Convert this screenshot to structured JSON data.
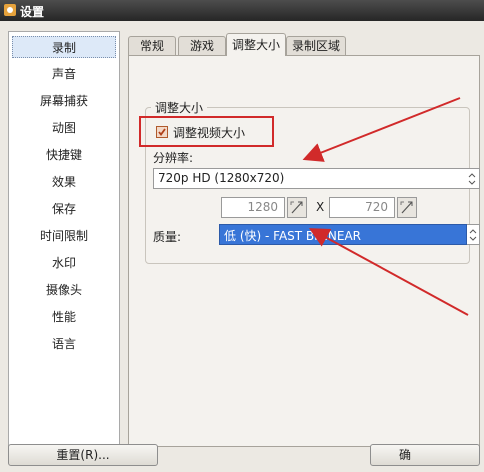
{
  "window": {
    "title": "设置"
  },
  "sidebar": {
    "items": [
      {
        "label": "录制",
        "selected": true
      },
      {
        "label": "声音"
      },
      {
        "label": "屏幕捕获"
      },
      {
        "label": "动图"
      },
      {
        "label": "快捷键"
      },
      {
        "label": "效果"
      },
      {
        "label": "保存"
      },
      {
        "label": "时间限制"
      },
      {
        "label": "水印"
      },
      {
        "label": "摄像头"
      },
      {
        "label": "性能"
      },
      {
        "label": "语言"
      }
    ]
  },
  "tabs": [
    {
      "label": "常规"
    },
    {
      "label": "游戏"
    },
    {
      "label": "调整大小",
      "active": true
    },
    {
      "label": "录制区域"
    }
  ],
  "resize": {
    "group_title": "调整大小",
    "checkbox_label": "调整视频大小",
    "checkbox_checked": true,
    "resolution_label": "分辨率:",
    "resolution_value": "720p HD (1280x720)",
    "width_value": "1280",
    "x_label": "X",
    "height_value": "720",
    "quality_label": "质量:",
    "quality_value": "低 (快) - FAST BILINEAR"
  },
  "footer": {
    "reset_label": "重置(R)...",
    "ok_label": "确"
  },
  "colors": {
    "annotation": "#d12a2a",
    "selection": "#3875d7"
  }
}
